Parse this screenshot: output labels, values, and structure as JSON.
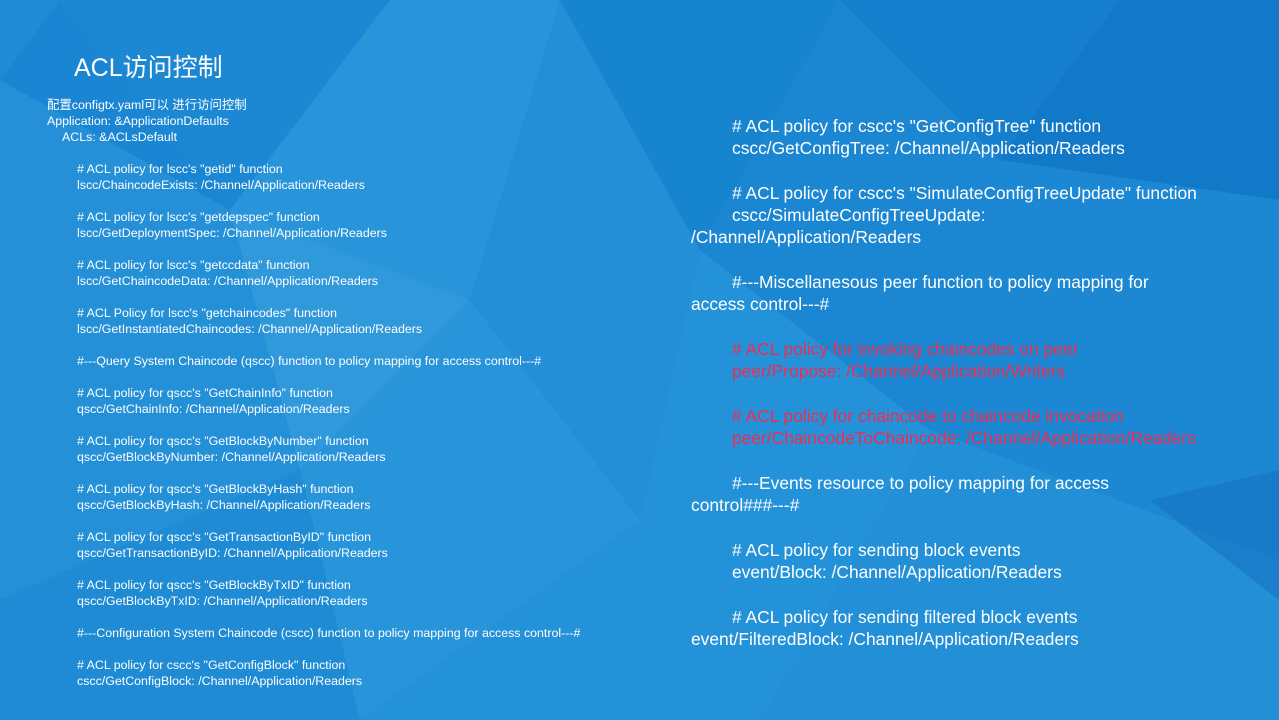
{
  "slide": {
    "title": "ACL访问控制",
    "left_lines": [
      {
        "text": "配置configtx.yaml可以 进行访问控制",
        "indent": 0
      },
      {
        "text": "Application: &ApplicationDefaults",
        "indent": 0
      },
      {
        "text": "ACLs: &ACLsDefault",
        "indent": 1
      },
      {
        "text": "",
        "indent": 0
      },
      {
        "text": "# ACL policy for lscc's \"getid\" function",
        "indent": 2
      },
      {
        "text": "lscc/ChaincodeExists: /Channel/Application/Readers",
        "indent": 2
      },
      {
        "text": "",
        "indent": 0
      },
      {
        "text": "# ACL policy for lscc's \"getdepspec\" function",
        "indent": 2
      },
      {
        "text": "lscc/GetDeploymentSpec: /Channel/Application/Readers",
        "indent": 2
      },
      {
        "text": "",
        "indent": 0
      },
      {
        "text": "# ACL policy for lscc's \"getccdata\" function",
        "indent": 2
      },
      {
        "text": "lscc/GetChaincodeData: /Channel/Application/Readers",
        "indent": 2
      },
      {
        "text": "",
        "indent": 0
      },
      {
        "text": "# ACL Policy for lscc's \"getchaincodes\" function",
        "indent": 2
      },
      {
        "text": "lscc/GetInstantiatedChaincodes: /Channel/Application/Readers",
        "indent": 2
      },
      {
        "text": "",
        "indent": 0
      },
      {
        "text": "#---Query System Chaincode (qscc) function to policy mapping for access control---#",
        "indent": 2
      },
      {
        "text": "",
        "indent": 0
      },
      {
        "text": "# ACL policy for qscc's \"GetChainInfo\" function",
        "indent": 2
      },
      {
        "text": "qscc/GetChainInfo: /Channel/Application/Readers",
        "indent": 2
      },
      {
        "text": "",
        "indent": 0
      },
      {
        "text": "# ACL policy for qscc's \"GetBlockByNumber\" function",
        "indent": 2
      },
      {
        "text": "qscc/GetBlockByNumber: /Channel/Application/Readers",
        "indent": 2
      },
      {
        "text": "",
        "indent": 0
      },
      {
        "text": "# ACL policy for qscc's  \"GetBlockByHash\" function",
        "indent": 2
      },
      {
        "text": "qscc/GetBlockByHash: /Channel/Application/Readers",
        "indent": 2
      },
      {
        "text": "",
        "indent": 0
      },
      {
        "text": "# ACL policy for qscc's \"GetTransactionByID\" function",
        "indent": 2
      },
      {
        "text": "qscc/GetTransactionByID: /Channel/Application/Readers",
        "indent": 2
      },
      {
        "text": "",
        "indent": 0
      },
      {
        "text": "# ACL policy for qscc's \"GetBlockByTxID\" function",
        "indent": 2
      },
      {
        "text": "qscc/GetBlockByTxID: /Channel/Application/Readers",
        "indent": 2
      },
      {
        "text": "",
        "indent": 0
      },
      {
        "text": "#---Configuration System Chaincode (cscc) function to policy mapping for access control---#",
        "indent": 2
      },
      {
        "text": "",
        "indent": 0
      },
      {
        "text": "# ACL policy for cscc's \"GetConfigBlock\" function",
        "indent": 2
      },
      {
        "text": "cscc/GetConfigBlock: /Channel/Application/Readers",
        "indent": 2
      }
    ],
    "right_blocks": [
      {
        "highlight": false,
        "lines": [
          {
            "text": "# ACL policy for cscc's \"GetConfigTree\" function",
            "indent": true
          },
          {
            "text": "cscc/GetConfigTree: /Channel/Application/Readers",
            "indent": true
          }
        ]
      },
      {
        "highlight": false,
        "lines": [
          {
            "text": "# ACL policy for cscc's \"SimulateConfigTreeUpdate\" function",
            "indent": true
          },
          {
            "text": "cscc/SimulateConfigTreeUpdate:",
            "indent": true
          },
          {
            "text": "/Channel/Application/Readers",
            "indent": false
          }
        ]
      },
      {
        "highlight": false,
        "lines": [
          {
            "text": "#---Miscellanesous peer function to policy mapping for",
            "indent": true
          },
          {
            "text": "access control---#",
            "indent": false
          }
        ]
      },
      {
        "highlight": true,
        "lines": [
          {
            "text": "# ACL policy for invoking chaincodes on peer",
            "indent": true
          },
          {
            "text": "peer/Propose: /Channel/Application/Writers",
            "indent": true
          }
        ]
      },
      {
        "highlight": true,
        "lines": [
          {
            "text": "# ACL policy for chaincode to chaincode invocation",
            "indent": true
          },
          {
            "text": "peer/ChaincodeToChaincode: /Channel/Application/Readers",
            "indent": true
          }
        ]
      },
      {
        "highlight": false,
        "lines": [
          {
            "text": "#---Events resource to policy mapping for access",
            "indent": true
          },
          {
            "text": "control###---#",
            "indent": false
          }
        ]
      },
      {
        "highlight": false,
        "lines": [
          {
            "text": "# ACL policy for sending block events",
            "indent": true
          },
          {
            "text": "event/Block: /Channel/Application/Readers",
            "indent": true
          }
        ]
      },
      {
        "highlight": false,
        "lines": [
          {
            "text": "# ACL policy for sending filtered block events",
            "indent": true
          },
          {
            "text": "event/FilteredBlock: /Channel/Application/Readers",
            "indent": false
          }
        ]
      }
    ]
  },
  "colors": {
    "background": "#1a85d2",
    "text": "#ffffff",
    "highlight_text": "#ef2c52"
  }
}
